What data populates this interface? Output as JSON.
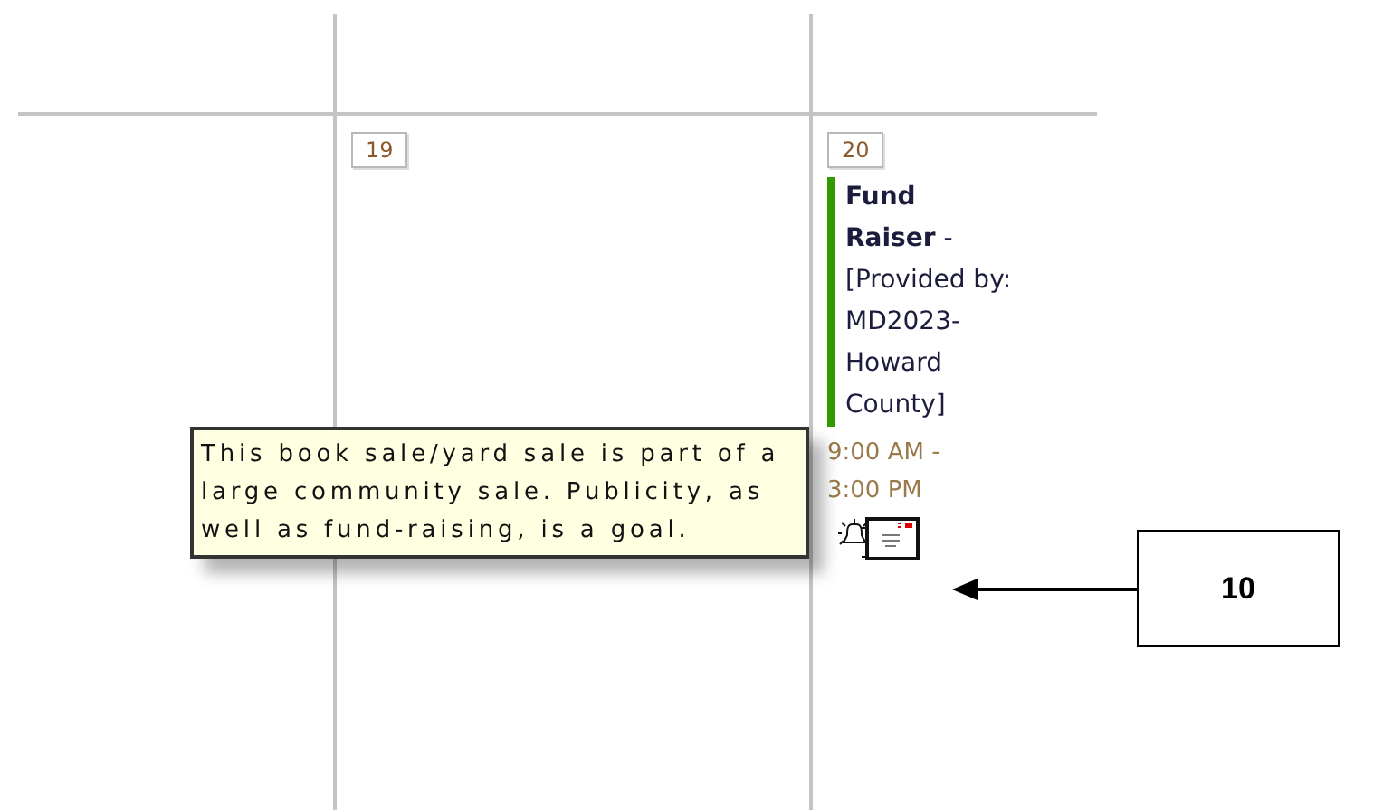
{
  "days": [
    {
      "number": "19"
    },
    {
      "number": "20",
      "events": [
        {
          "title": "**Fund Raiser** - [Provided by: MD2023-Howard County]",
          "time": "9:00 AM - 3:00 PM",
          "color": "#339900"
        }
      ]
    }
  ],
  "tooltip": {
    "text": "This book sale/yard sale is part of a large community sale. Publicity, as well as fund-raising, is a goal."
  },
  "callout": {
    "label": "10"
  }
}
